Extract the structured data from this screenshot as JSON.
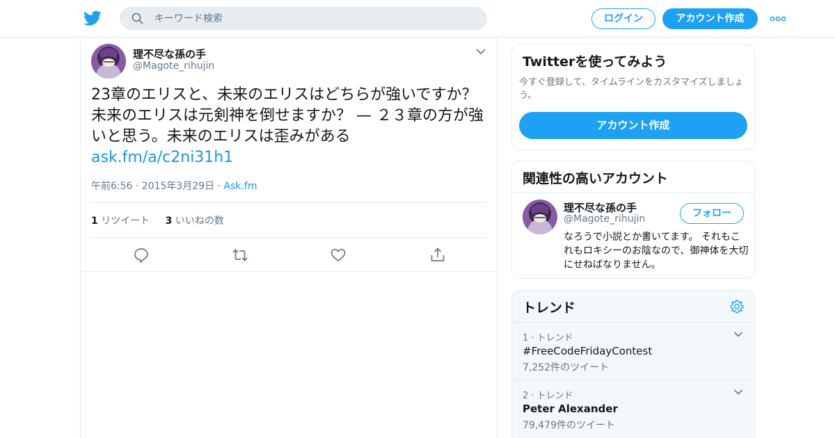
{
  "header": {
    "search_placeholder": "キーワード検索",
    "login_label": "ログイン",
    "signup_label": "アカウント作成"
  },
  "tweet": {
    "display_name": "理不尽な孫の手",
    "handle": "@Magote_rihujin",
    "text": "23章のエリスと、未来のエリスはどちらが強いですか？ 未来のエリスは元剣神を倒せますか？ — ２３章の方が強いと思う。未来のエリスは歪みがある",
    "link": "ask.fm/a/c2ni31h1",
    "timestamp": "午前6:56 · 2015年3月29日 ·",
    "source": "Ask.fm",
    "retweets": {
      "count": "1",
      "label": "リツイート"
    },
    "likes": {
      "count": "3",
      "label": "いいねの数"
    }
  },
  "signup_module": {
    "title": "Twitterを使ってみよう",
    "description": "今すぐ登録して、タイムラインをカスタマイズしましょう。",
    "button": "アカウント作成"
  },
  "related_module": {
    "title": "関連性の高いアカウント",
    "account": {
      "display_name": "理不尽な孫の手",
      "handle": "@Magote_rihujin",
      "follow_label": "フォロー",
      "bio": "なろうで小説とか書いてます。 それもこれもロキシーのお陰なので、御神体を大切にせねばなりません。"
    }
  },
  "trends_module": {
    "title": "トレンド",
    "items": [
      {
        "meta": "1 · トレンド",
        "name": "#FreeCodeFridayContest",
        "count": "7,252件のツイート"
      },
      {
        "meta": "2 · トレンド",
        "name": "Peter Alexander",
        "count": "79,479件のツイート"
      }
    ]
  },
  "colors": {
    "accent": "#1da1f2",
    "link": "#1b95e0",
    "text": "#14171a",
    "muted": "#657786",
    "border": "#e6ecf0",
    "search_bg": "#e6ecf0",
    "trends_bg": "#f5f8fa"
  }
}
